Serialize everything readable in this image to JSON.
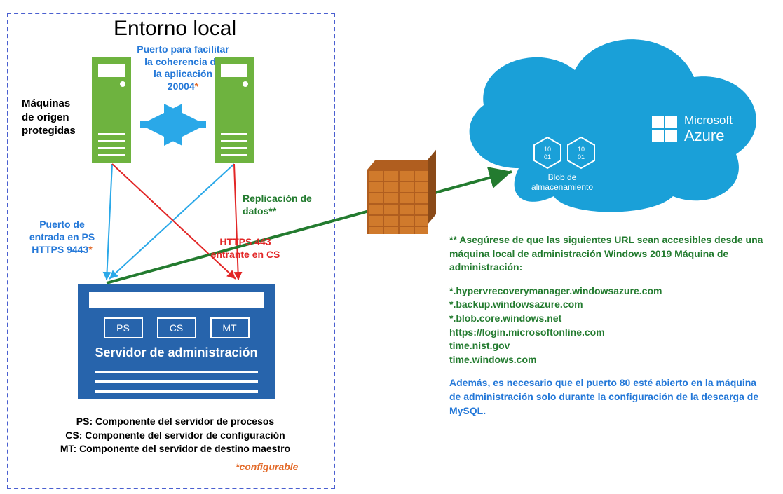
{
  "onprem": {
    "title": "Entorno local",
    "port_app_l1": "Puerto para facilitar",
    "port_app_l2": "la coherencia de",
    "port_app_l3": "la aplicación",
    "port_app_num": "20004",
    "port_app_ast": "*",
    "sources_l1": "Máquinas",
    "sources_l2": "de origen",
    "sources_l3": "protegidas",
    "ps_l1": "Puerto de",
    "ps_l2": "entrada en PS",
    "ps_l3_a": "HTTPS 9443",
    "ps_l3_ast": "*",
    "cs_l1": "HTTPS 443",
    "cs_l2": "entrante en CS",
    "replication_l1": "Replicación de",
    "replication_l2": "datos**",
    "mgmt": {
      "box_ps": "PS",
      "box_cs": "CS",
      "box_mt": "MT",
      "title": "Servidor de administración"
    },
    "legend_ps": "PS: Componente del servidor de procesos",
    "legend_cs": "CS: Componente del servidor de configuración",
    "legend_mt": "MT: Componente del servidor de destino maestro",
    "configurable": "*configurable"
  },
  "azure": {
    "brand_top": "Microsoft",
    "brand_bottom": "Azure",
    "blob_l1": "Blob de",
    "blob_l2": "almacenamiento"
  },
  "notes": {
    "header": "** Asegúrese de que las siguientes URL sean accesibles desde una máquina local de administración Windows 2019 Máquina de administración:",
    "urls": {
      "u1": "*.hypervrecoverymanager.windowsazure.com",
      "u2": "*.backup.windowsazure.com",
      "u3": "*.blob.core.windows.net",
      "u4": "https://login.microsoftonline.com",
      "u5": "time.nist.gov",
      "u6": "time.windows.com"
    },
    "port80": "Además, es necesario que el puerto 80 esté abierto en la máquina de administración solo durante la configuración de la descarga de MySQL."
  }
}
